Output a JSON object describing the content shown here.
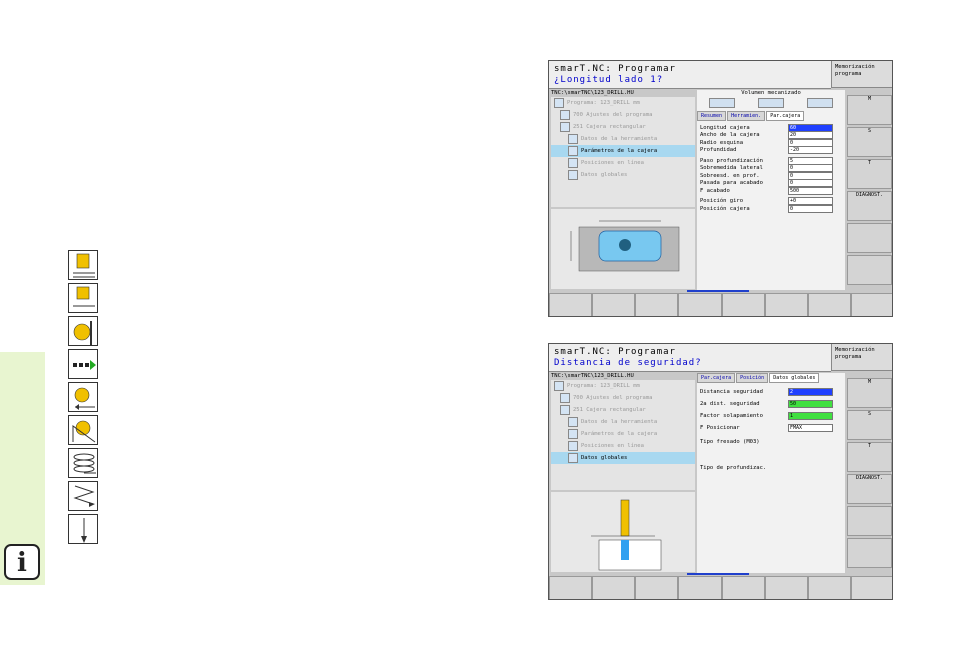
{
  "left_panel": {
    "info_label": "i",
    "cycle_icons": [
      "drill-icon",
      "drill-icon",
      "pocket-icon",
      "arrows-right-icon",
      "pocket-finish-icon",
      "contour-icon",
      "helix-icon",
      "zigzag-icon",
      "arrow-down-icon"
    ]
  },
  "screen1": {
    "title": "smarT.NC: Programar",
    "question": "¿Longitud lado 1?",
    "mode": "Memorización programa",
    "path": "TNC:\\smarTNC\\123_DRILL.HU",
    "tree": [
      {
        "text": "Programa: 123_DRILL mm",
        "selected": false
      },
      {
        "text": "700 Ajustes del programa",
        "selected": false
      },
      {
        "text": "251 Cajera rectangular",
        "selected": false
      },
      {
        "text": "Datos de la herramienta",
        "selected": false
      },
      {
        "text": "Parámetros de la cajera",
        "selected": true
      },
      {
        "text": "Posiciones en línea",
        "selected": false
      },
      {
        "text": "Datos globales",
        "selected": false
      }
    ],
    "volume_label": "Volumen mecanizado",
    "tabs": [
      "Resumen",
      "Herramien.",
      "Par.cajera"
    ],
    "active_tab": "Par.cajera",
    "fields": [
      {
        "label": "Longitud cajera",
        "value": "60"
      },
      {
        "label": "Ancho de la cajera",
        "value": "20"
      },
      {
        "label": "Radio esquina",
        "value": "0"
      },
      {
        "label": "Profundidad",
        "value": "-20"
      },
      {
        "label": "Paso profundización",
        "value": "5"
      },
      {
        "label": "Sobremedida lateral",
        "value": "0"
      },
      {
        "label": "Sobreesd. en prof.",
        "value": "0"
      },
      {
        "label": "Pasada para acabado",
        "value": "0"
      },
      {
        "label": "F acabado",
        "value": "500"
      },
      {
        "label": "Posición giro",
        "value": "+0"
      },
      {
        "label": "Posición cajera",
        "value": "0"
      }
    ],
    "side_buttons": [
      "M",
      "S",
      "T",
      "DIAGNOST."
    ]
  },
  "screen2": {
    "title": "smarT.NC: Programar",
    "question": "Distancia de seguridad?",
    "mode": "Memorización programa",
    "path": "TNC:\\smarTNC\\123_DRILL.HU",
    "tree": [
      {
        "text": "Programa: 123_DRILL mm",
        "selected": false
      },
      {
        "text": "700 Ajustes del programa",
        "selected": false
      },
      {
        "text": "251 Cajera rectangular",
        "selected": false
      },
      {
        "text": "Datos de la herramienta",
        "selected": false
      },
      {
        "text": "Parámetros de la cajera",
        "selected": false
      },
      {
        "text": "Posiciones en línea",
        "selected": false
      },
      {
        "text": "Datos globales",
        "selected": true
      }
    ],
    "tabs": [
      "Par.cajera",
      "Posición",
      "Datos globales"
    ],
    "active_tab": "Datos globales",
    "fields": [
      {
        "label": "Distancia seguridad",
        "value": "2",
        "style": "blue"
      },
      {
        "label": "2a dist. seguridad",
        "value": "50",
        "style": "green"
      },
      {
        "label": "Factor solapamiento",
        "value": "1",
        "style": "green"
      },
      {
        "label": "F Posicionar",
        "value": "FMAX",
        "style": "plain"
      }
    ],
    "extra_labels": [
      "Tipo fresado (M03)",
      "Tipo de profundizac."
    ],
    "side_buttons": [
      "M",
      "S",
      "T",
      "DIAGNOST."
    ]
  }
}
